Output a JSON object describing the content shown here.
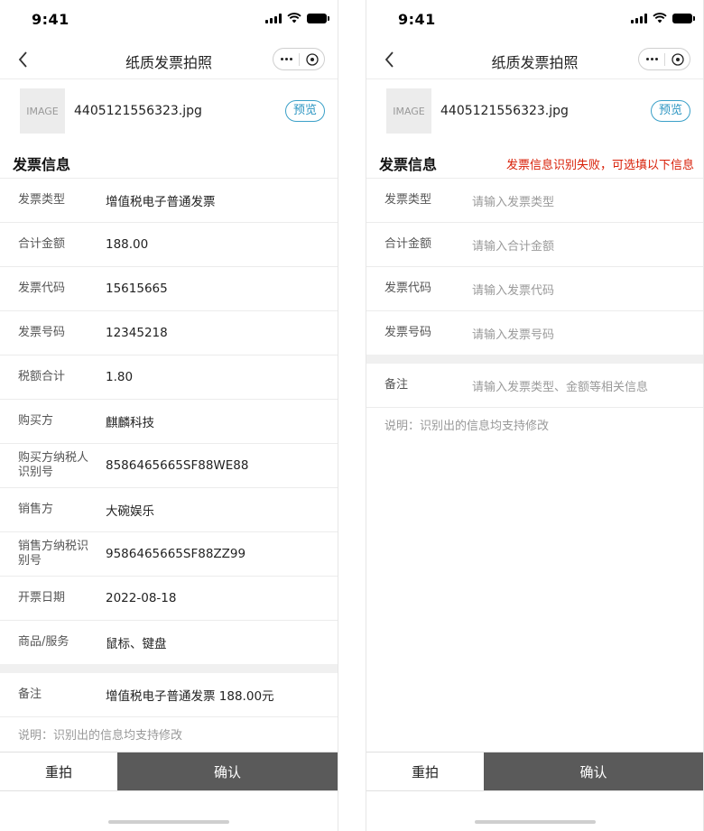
{
  "status": {
    "time": "9:41"
  },
  "nav": {
    "title": "纸质发票拍照"
  },
  "file": {
    "thumb_label": "IMAGE",
    "name": "4405121556323.jpg",
    "preview_label": "预览"
  },
  "section": {
    "title": "发票信息",
    "error_msg": "发票信息识别失败，可选填以下信息"
  },
  "left_fields": [
    {
      "label": "发票类型",
      "value": "增值税电子普通发票"
    },
    {
      "label": "合计金额",
      "value": "188.00"
    },
    {
      "label": "发票代码",
      "value": "15615665"
    },
    {
      "label": "发票号码",
      "value": "12345218"
    },
    {
      "label": "税额合计",
      "value": "1.80"
    },
    {
      "label": "购买方",
      "value": "麒麟科技"
    },
    {
      "label": "购买方纳税人识别号",
      "value": "8586465665SF88WE88"
    },
    {
      "label": "销售方",
      "value": "大碗娱乐"
    },
    {
      "label": "销售方纳税识别号",
      "value": "9586465665SF88ZZ99"
    },
    {
      "label": "开票日期",
      "value": "2022-08-18"
    },
    {
      "label": "商品/服务",
      "value": "鼠标、键盘"
    }
  ],
  "left_remark": {
    "label": "备注",
    "value": "增值税电子普通发票 188.00元"
  },
  "right_fields": [
    {
      "label": "发票类型",
      "placeholder": "请输入发票类型"
    },
    {
      "label": "合计金额",
      "placeholder": "请输入合计金额"
    },
    {
      "label": "发票代码",
      "placeholder": "请输入发票代码"
    },
    {
      "label": "发票号码",
      "placeholder": "请输入发票号码"
    }
  ],
  "right_remark": {
    "label": "备注",
    "placeholder": "请输入发票类型、金额等相关信息"
  },
  "note": "说明：识别出的信息均支持修改",
  "buttons": {
    "retake": "重拍",
    "confirm": "确认"
  }
}
